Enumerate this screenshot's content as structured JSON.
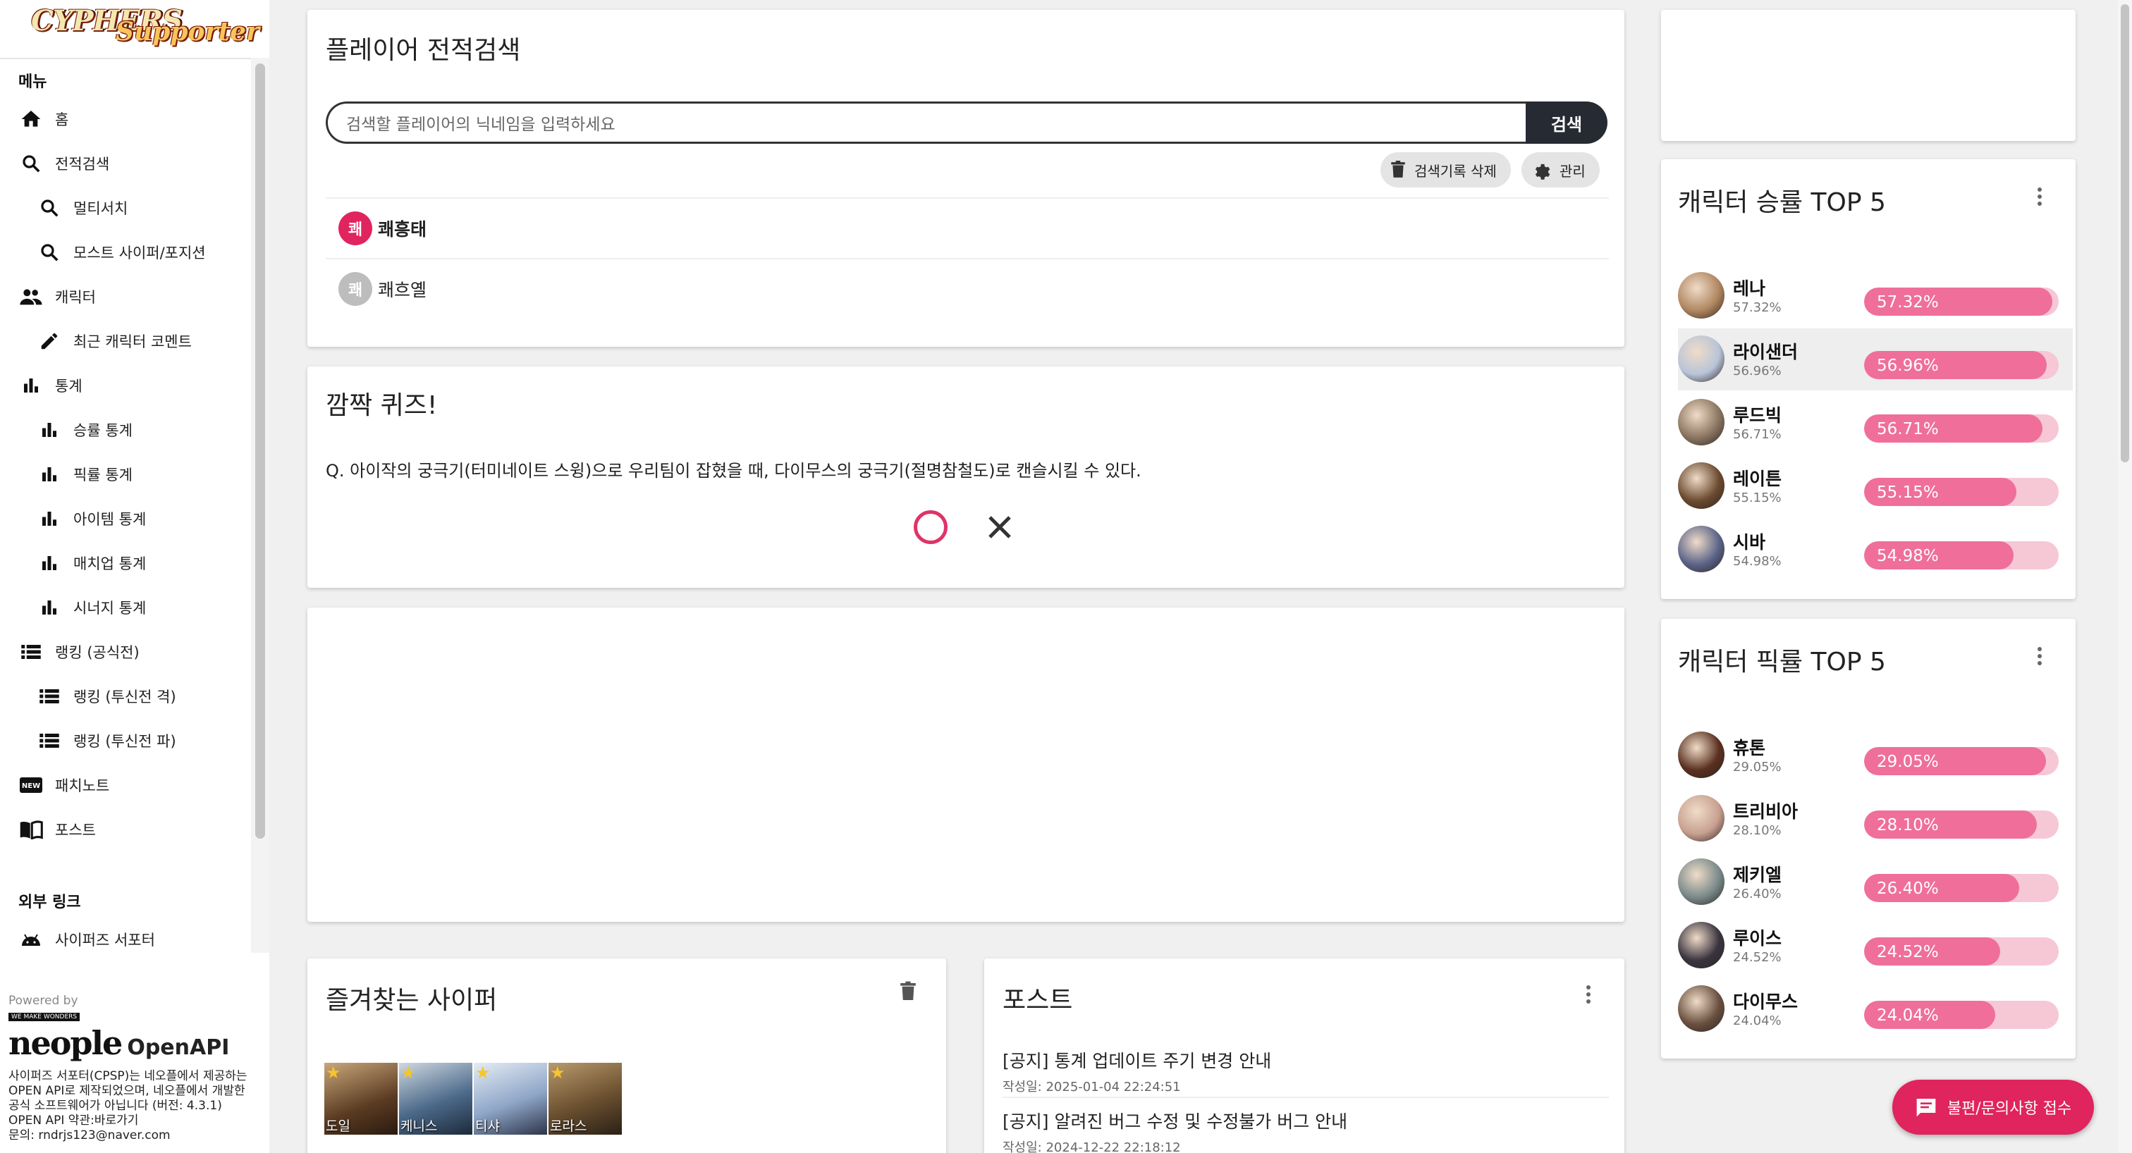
{
  "logo": {
    "line1": "CYPHERS",
    "line2": "Supporter"
  },
  "sidebar": {
    "menu_header": "메뉴",
    "items": [
      {
        "label": "홈",
        "icon": "home-icon"
      },
      {
        "label": "전적검색",
        "icon": "search-icon"
      },
      {
        "label": "멀티서치",
        "icon": "search-icon"
      },
      {
        "label": "모스트 사이퍼/포지션",
        "icon": "search-icon"
      },
      {
        "label": "캐릭터",
        "icon": "people-icon"
      },
      {
        "label": "최근 캐릭터 코멘트",
        "icon": "pencil-icon"
      },
      {
        "label": "통계",
        "icon": "bar-chart-icon"
      },
      {
        "label": "승률 통계",
        "icon": "bar-chart-icon"
      },
      {
        "label": "픽률 통계",
        "icon": "bar-chart-icon"
      },
      {
        "label": "아이템 통계",
        "icon": "bar-chart-icon"
      },
      {
        "label": "매치업 통계",
        "icon": "bar-chart-icon"
      },
      {
        "label": "시너지 통계",
        "icon": "bar-chart-icon"
      },
      {
        "label": "랭킹 (공식전)",
        "icon": "list-icon"
      },
      {
        "label": "랭킹 (투신전 격)",
        "icon": "list-icon"
      },
      {
        "label": "랭킹 (투신전 파)",
        "icon": "list-icon"
      },
      {
        "label": "패치노트",
        "icon": "new-badge-icon"
      },
      {
        "label": "포스트",
        "icon": "book-icon"
      }
    ],
    "external_header": "외부 링크",
    "external_items": [
      {
        "label": "사이퍼즈 서포터",
        "icon": "android-icon"
      }
    ],
    "footer": {
      "powered_by": "Powered by",
      "brand_small": "WE MAKE WONDERS",
      "brand": "neople",
      "brand_suffix": "OpenAPI",
      "lines": [
        "사이퍼즈 서포터(CPSP)는 네오플에서 제공하는",
        "OPEN API로 제작되었으며, 네오플에서 개발한",
        "공식 소프트웨어가 아닙니다 (버전: 4.3.1)",
        "OPEN API 약관:바로가기",
        "문의: rndrjs123@naver.com"
      ]
    }
  },
  "search_card": {
    "title": "플레이어 전적검색",
    "placeholder": "검색할 플레이어의 닉네임을 입력하세요",
    "search_button": "검색",
    "delete_history": "검색기록 삭제",
    "manage": "관리",
    "history": [
      {
        "initial": "쾌",
        "name": "쾌흥태",
        "active": true
      },
      {
        "initial": "쾌",
        "name": "쾌흐옐",
        "active": false
      }
    ]
  },
  "quiz_card": {
    "title": "깜짝 퀴즈!",
    "question": "Q. 아이작의 궁극기(터미네이트 스윙)으로 우리팀이 잡혔을 때, 다이무스의 궁극기(절명참철도)로 캔슬시킬 수 있다."
  },
  "favorites_card": {
    "title": "즐겨찾는 사이퍼",
    "items": [
      {
        "name": "도일"
      },
      {
        "name": "케니스"
      },
      {
        "name": "티샤"
      },
      {
        "name": "로라스"
      }
    ]
  },
  "posts_card": {
    "title": "포스트",
    "items": [
      {
        "title": "[공지] 통계 업데이트 주기 변경 안내",
        "date": "작성일: 2025-01-04 22:24:51"
      },
      {
        "title": "[공지] 알려진 버그 수정 및 수정불가 버그 안내",
        "date": "작성일: 2024-12-22 22:18:12"
      }
    ]
  },
  "winrate_card": {
    "title": "캐릭터 승률 TOP 5",
    "items": [
      {
        "name": "레나",
        "value": 57.32,
        "label": "57.32%"
      },
      {
        "name": "라이샌더",
        "value": 56.96,
        "label": "56.96%"
      },
      {
        "name": "루드빅",
        "value": 56.71,
        "label": "56.71%"
      },
      {
        "name": "레이튼",
        "value": 55.15,
        "label": "55.15%"
      },
      {
        "name": "시바",
        "value": 54.98,
        "label": "54.98%"
      }
    ]
  },
  "pickrate_card": {
    "title": "캐릭터 픽률 TOP 5",
    "items": [
      {
        "name": "휴톤",
        "value": 29.05,
        "label": "29.05%"
      },
      {
        "name": "트리비아",
        "value": 28.1,
        "label": "28.10%"
      },
      {
        "name": "제키엘",
        "value": 26.4,
        "label": "26.40%"
      },
      {
        "name": "루이스",
        "value": 24.52,
        "label": "24.52%"
      },
      {
        "name": "다이무스",
        "value": 24.04,
        "label": "24.04%"
      }
    ]
  },
  "feedback_button": "불편/문의사항 접수",
  "colors": {
    "accent": "#e0245e",
    "bar_fill": "#ef6f9a",
    "bar_track": "#f6c7d5",
    "search_button": "#262b33"
  }
}
